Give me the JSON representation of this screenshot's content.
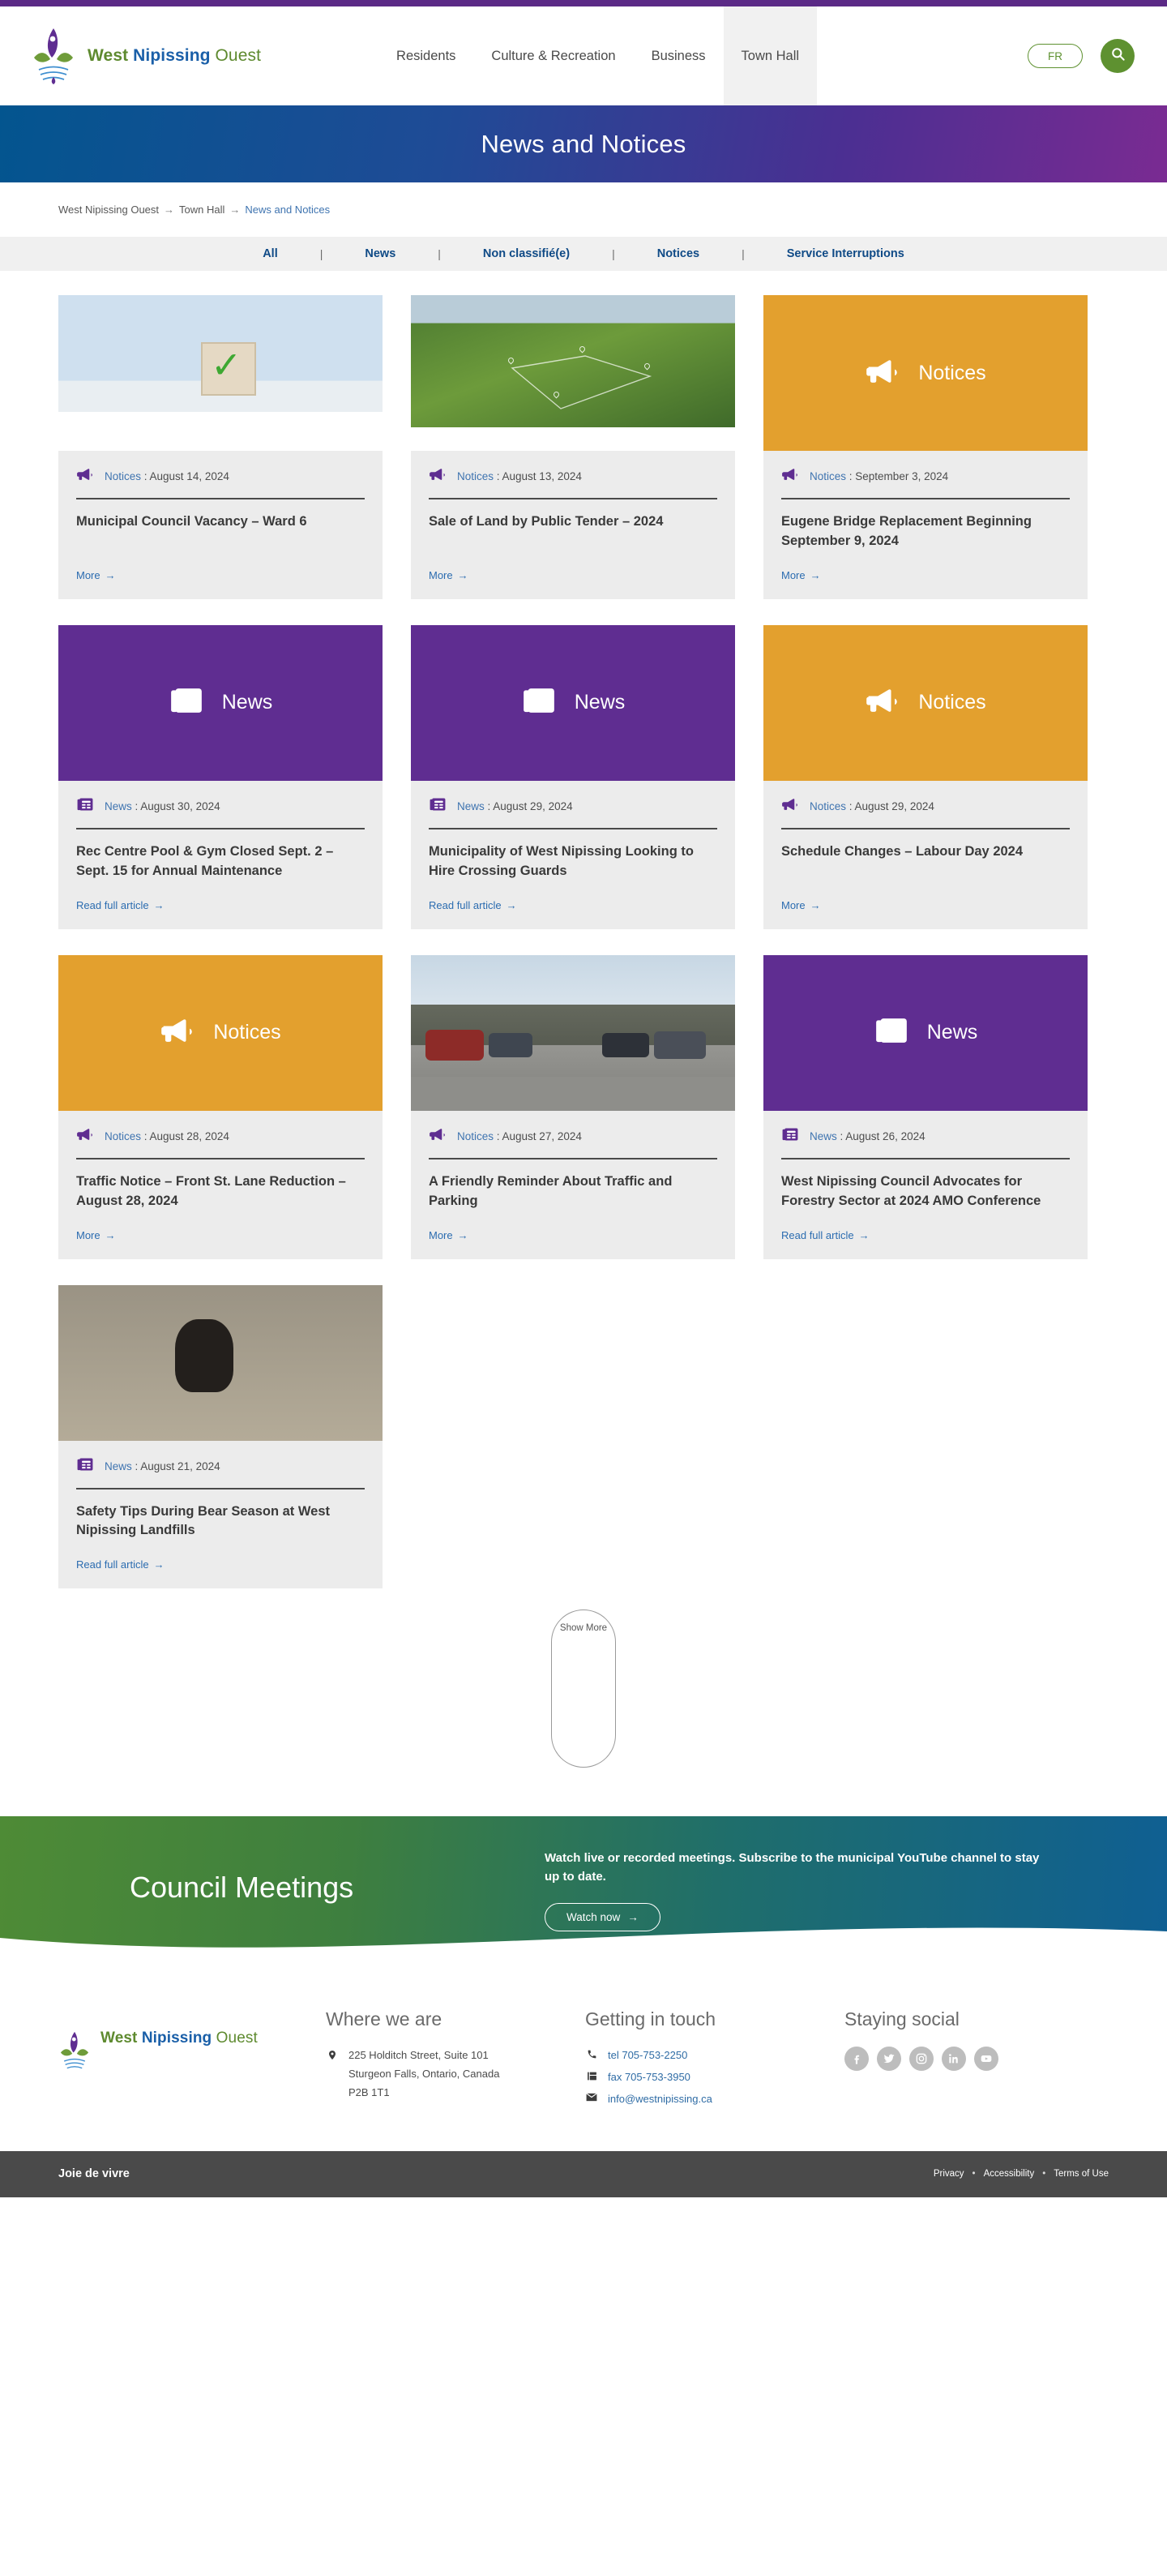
{
  "brand": {
    "word1": "West",
    "word2": "Nipissing",
    "word3": "Ouest"
  },
  "nav": {
    "items": [
      {
        "label": "Residents",
        "active": false
      },
      {
        "label": "Culture & Recreation",
        "active": false
      },
      {
        "label": "Business",
        "active": false
      },
      {
        "label": "Town Hall",
        "active": true
      }
    ],
    "lang_label": "FR",
    "search_icon": "search-icon"
  },
  "hero": {
    "title": "News and Notices"
  },
  "breadcrumb": {
    "items": [
      "West Nipissing Ouest",
      "Town Hall",
      "News and Notices"
    ],
    "separator": "→"
  },
  "filters": {
    "items": [
      "All",
      "News",
      "Non classifié(e)",
      "Notices",
      "Service Interruptions"
    ],
    "divider": "|"
  },
  "cards": [
    {
      "media_type": "photo",
      "photo": "checkbox-ballot",
      "category": "Notices",
      "date": "August 14, 2024",
      "separator": " : ",
      "title": "Municipal Council Vacancy – Ward 6",
      "link_label": "More",
      "icon": "megaphone-icon"
    },
    {
      "media_type": "photo",
      "photo": "aerial-field",
      "category": "Notices",
      "date": "August 13, 2024",
      "separator": " : ",
      "title": "Sale of Land by Public Tender – 2024",
      "link_label": "More",
      "icon": "megaphone-icon"
    },
    {
      "media_type": "banner",
      "banner_kind": "notices",
      "banner_label": "Notices",
      "category": "Notices",
      "date": "September 3, 2024",
      "separator": " : ",
      "title": "Eugene Bridge Replacement Beginning September 9, 2024",
      "link_label": "More",
      "icon": "megaphone-icon"
    },
    {
      "media_type": "banner",
      "banner_kind": "news",
      "banner_label": "News",
      "category": "News",
      "date": "August 30, 2024",
      "separator": " : ",
      "title": "Rec Centre Pool & Gym Closed Sept. 2 – Sept. 15 for Annual Maintenance",
      "link_label": "Read full article",
      "icon": "newspaper-icon"
    },
    {
      "media_type": "banner",
      "banner_kind": "news",
      "banner_label": "News",
      "category": "News",
      "date": "August 29, 2024",
      "separator": " : ",
      "title": "Municipality of West Nipissing Looking to Hire Crossing Guards",
      "link_label": "Read full article",
      "icon": "newspaper-icon"
    },
    {
      "media_type": "banner",
      "banner_kind": "notices",
      "banner_label": "Notices",
      "category": "Notices",
      "date": "August 29, 2024",
      "separator": " : ",
      "title": "Schedule Changes – Labour Day 2024",
      "link_label": "More",
      "icon": "megaphone-icon"
    },
    {
      "media_type": "banner",
      "banner_kind": "notices",
      "banner_label": "Notices",
      "category": "Notices",
      "date": "August 28, 2024",
      "separator": " : ",
      "title": "Traffic Notice – Front St. Lane Reduction – August 28, 2024",
      "link_label": "More",
      "icon": "megaphone-icon"
    },
    {
      "media_type": "photo",
      "photo": "street-parking",
      "category": "Notices",
      "date": "August 27, 2024",
      "separator": " : ",
      "title": "A Friendly Reminder About Traffic and Parking",
      "link_label": "More",
      "icon": "megaphone-icon"
    },
    {
      "media_type": "banner",
      "banner_kind": "news",
      "banner_label": "News",
      "category": "News",
      "date": "August 26, 2024",
      "separator": " : ",
      "title": "West Nipissing Council Advocates for Forestry Sector at 2024 AMO Conference",
      "link_label": "Read full article",
      "icon": "newspaper-icon"
    },
    {
      "media_type": "photo",
      "photo": "bear-landfill",
      "category": "News",
      "date": "August 21, 2024",
      "separator": " : ",
      "title": "Safety Tips During Bear Season at West Nipissing Landfills",
      "link_label": "Read full article",
      "icon": "newspaper-icon"
    }
  ],
  "show_more": {
    "label": "Show More"
  },
  "cta": {
    "title": "Council Meetings",
    "copy": "Watch live or recorded meetings. Subscribe to the municipal YouTube channel to stay up to date.",
    "button_label": "Watch now",
    "arrow": "→"
  },
  "footer": {
    "where": {
      "heading": "Where we are",
      "address_line1": "225 Holditch Street, Suite 101",
      "address_line2": "Sturgeon Falls, Ontario, Canada",
      "address_line3": "P2B 1T1",
      "icon": "map-pin-icon"
    },
    "touch": {
      "heading": "Getting in touch",
      "tel": "tel 705-753-2250",
      "fax": "fax 705-753-3950",
      "email": "info@westnipissing.ca",
      "tel_icon": "phone-icon",
      "fax_icon": "fax-icon",
      "email_icon": "envelope-icon"
    },
    "social": {
      "heading": "Staying social",
      "items": [
        "facebook-icon",
        "twitter-icon",
        "instagram-icon",
        "linkedin-icon",
        "youtube-icon"
      ]
    }
  },
  "bottom": {
    "tagline": "Joie de vivre",
    "links": [
      "Privacy",
      "Accessibility",
      "Terms of Use"
    ],
    "dot": "•"
  },
  "colors": {
    "purple": "#5f2d91",
    "orange": "#e3a02e",
    "green": "#5e9130",
    "link_blue": "#2b6cb0",
    "filter_blue": "#0f4a86",
    "footer_grey": "#4a4a4a"
  }
}
